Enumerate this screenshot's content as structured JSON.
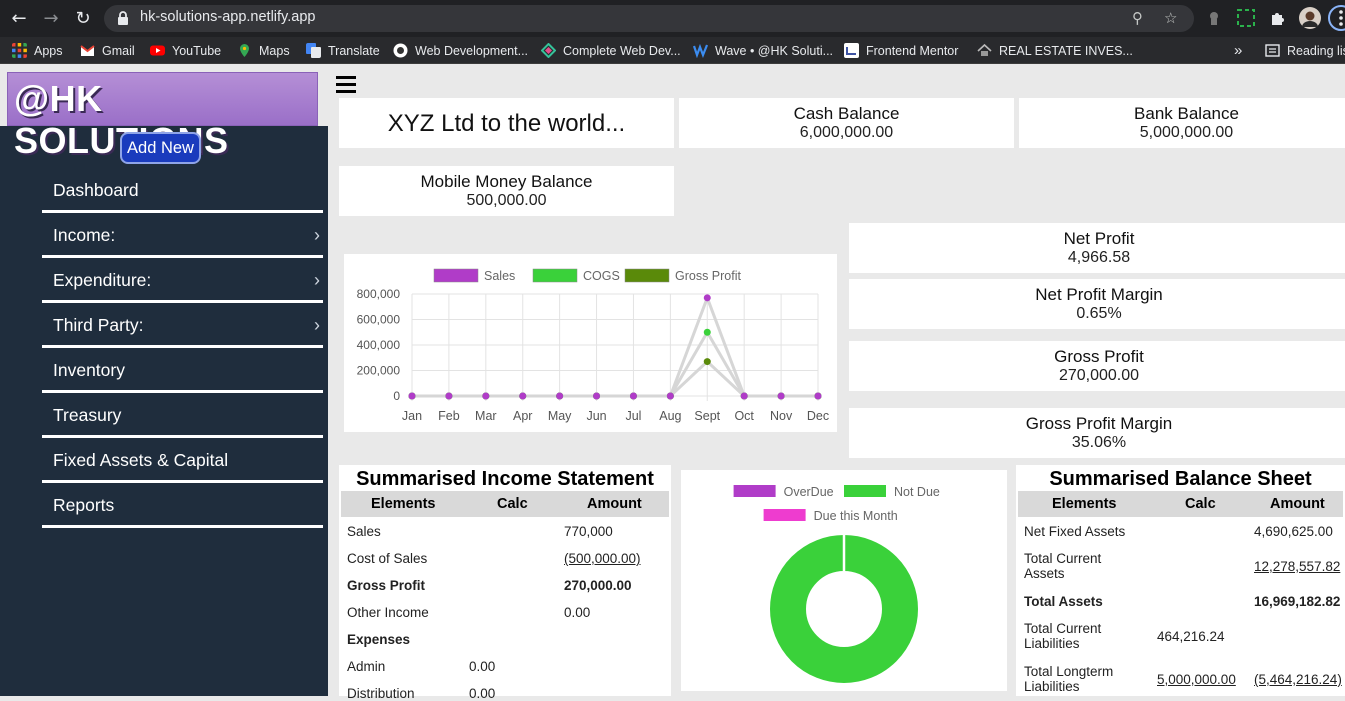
{
  "browser": {
    "url": "hk-solutions-app.netlify.app",
    "bookmarks": [
      "Apps",
      "Gmail",
      "YouTube",
      "Maps",
      "Translate",
      "Web Development...",
      "Complete Web Dev...",
      "Wave • @HK Soluti...",
      "Frontend Mentor",
      "REAL ESTATE INVES..."
    ],
    "overflow": "»",
    "reading_list": "Reading lis"
  },
  "sidebar": {
    "logo": "@HK SOLUTIONS",
    "add_new": "Add New",
    "items": [
      {
        "label": "Dashboard",
        "chevron": false
      },
      {
        "label": "Income:",
        "chevron": true
      },
      {
        "label": "Expenditure:",
        "chevron": true
      },
      {
        "label": "Third Party:",
        "chevron": true
      },
      {
        "label": "Inventory",
        "chevron": false
      },
      {
        "label": "Treasury",
        "chevron": false
      },
      {
        "label": "Fixed Assets & Capital",
        "chevron": false
      },
      {
        "label": "Reports",
        "chevron": false
      }
    ],
    "chevron_glyph": "›"
  },
  "header": {
    "company_title": "XYZ Ltd to the world..."
  },
  "balances": {
    "cash": {
      "label": "Cash Balance",
      "value": "6,000,000.00"
    },
    "bank": {
      "label": "Bank Balance",
      "value": "5,000,000.00"
    },
    "mobile": {
      "label": "Mobile Money Balance",
      "value": "500,000.00"
    }
  },
  "metrics": {
    "net_profit": {
      "label": "Net Profit",
      "value": "4,966.58"
    },
    "net_profit_margin": {
      "label": "Net Profit Margin",
      "value": "0.65%"
    },
    "gross_profit": {
      "label": "Gross Profit",
      "value": "270,000.00"
    },
    "gross_profit_margin": {
      "label": "Gross Profit Margin",
      "value": "35.06%"
    }
  },
  "income_statement": {
    "title": "Summarised Income Statement",
    "headers": [
      "Elements",
      "Calc",
      "Amount"
    ],
    "rows": [
      {
        "element": "Sales",
        "calc": "",
        "amount": "770,000"
      },
      {
        "element": "Cost of Sales",
        "calc": "",
        "amount": "(500,000.00)"
      },
      {
        "element": "Gross Profit",
        "calc": "",
        "amount": "270,000.00"
      },
      {
        "element": "Other Income",
        "calc": "",
        "amount": "0.00"
      },
      {
        "element": "Expenses",
        "calc": "",
        "amount": ""
      },
      {
        "element": "Admin",
        "calc": "0.00",
        "amount": ""
      },
      {
        "element": "Distribution",
        "calc": "0.00",
        "amount": ""
      }
    ]
  },
  "balance_sheet": {
    "title": "Summarised Balance Sheet",
    "headers": [
      "Elements",
      "Calc",
      "Amount"
    ],
    "rows": [
      {
        "element": "Net Fixed Assets",
        "calc": "",
        "amount": "4,690,625.00"
      },
      {
        "element": "Total Current Assets",
        "calc": "",
        "amount": "12,278,557.82"
      },
      {
        "element": "Total Assets",
        "calc": "",
        "amount": "16,969,182.82"
      },
      {
        "element": "Total Current Liabilities",
        "calc": "464,216.24",
        "amount": ""
      },
      {
        "element": "Total Longterm Liabilities",
        "calc": "5,000,000.00",
        "amount": "(5,464,216.24)"
      }
    ]
  },
  "chart_data": [
    {
      "type": "line",
      "categories": [
        "Jan",
        "Feb",
        "Mar",
        "Apr",
        "May",
        "Jun",
        "Jul",
        "Aug",
        "Sept",
        "Oct",
        "Nov",
        "Dec"
      ],
      "series": [
        {
          "name": "Sales",
          "color": "#b03cc8",
          "values": [
            0,
            0,
            0,
            0,
            0,
            0,
            0,
            0,
            770000,
            0,
            0,
            0
          ]
        },
        {
          "name": "COGS",
          "color": "#3ad13a",
          "values": [
            0,
            0,
            0,
            0,
            0,
            0,
            0,
            0,
            500000,
            0,
            0,
            0
          ]
        },
        {
          "name": "Gross Profit",
          "color": "#5a8a0a",
          "values": [
            0,
            0,
            0,
            0,
            0,
            0,
            0,
            0,
            270000,
            0,
            0,
            0
          ]
        }
      ],
      "yticks": [
        "0",
        "200,000",
        "400,000",
        "600,000",
        "800,000"
      ],
      "ylim": [
        0,
        800000
      ],
      "grid": true,
      "legend": "top"
    },
    {
      "type": "pie",
      "style": "doughnut",
      "categories": [
        "OverDue",
        "Not Due",
        "Due this Month"
      ],
      "colors": [
        "#b03cc8",
        "#3ad13a",
        "#ee3ccf"
      ],
      "values": [
        0,
        100,
        0
      ],
      "legend": "top"
    }
  ]
}
